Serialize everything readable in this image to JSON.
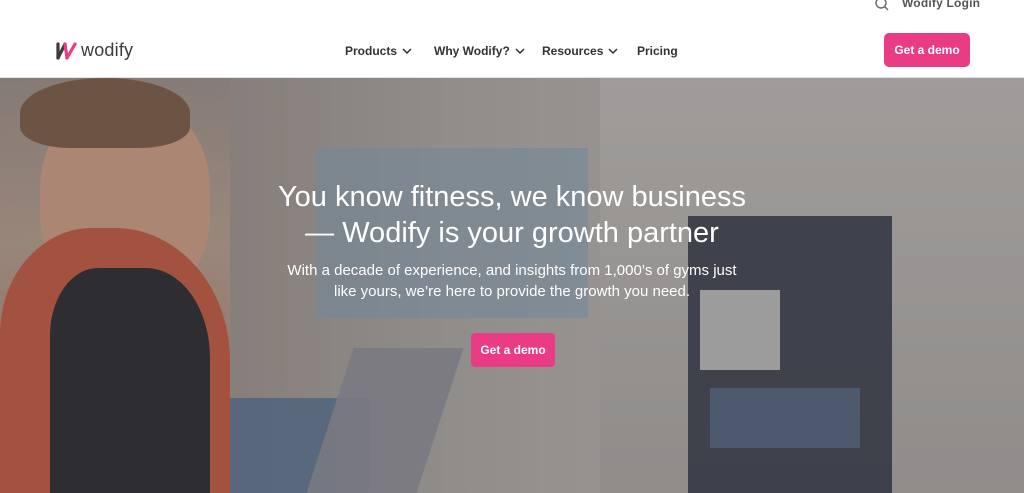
{
  "utility": {
    "search_icon": "search-icon",
    "login_label": "Wodify Login"
  },
  "header": {
    "logo_text": "wodify",
    "nav": [
      {
        "label": "Products",
        "has_dropdown": true
      },
      {
        "label": "Why Wodify?",
        "has_dropdown": true
      },
      {
        "label": "Resources",
        "has_dropdown": true
      },
      {
        "label": "Pricing",
        "has_dropdown": false
      }
    ],
    "cta_label": "Get a demo"
  },
  "hero": {
    "title_line1": "You know fitness, we know business",
    "title_line2": "— Wodify is your growth partner",
    "subtitle_line1": "With a decade of experience, and insights from 1,000’s of gyms just",
    "subtitle_line2": "like yours, we’re here to provide the growth you need.",
    "cta_label": "Get a demo"
  },
  "colors": {
    "accent": "#ea3b85",
    "logo_dark": "#3b3b3b",
    "logo_pink": "#ea3b85"
  }
}
